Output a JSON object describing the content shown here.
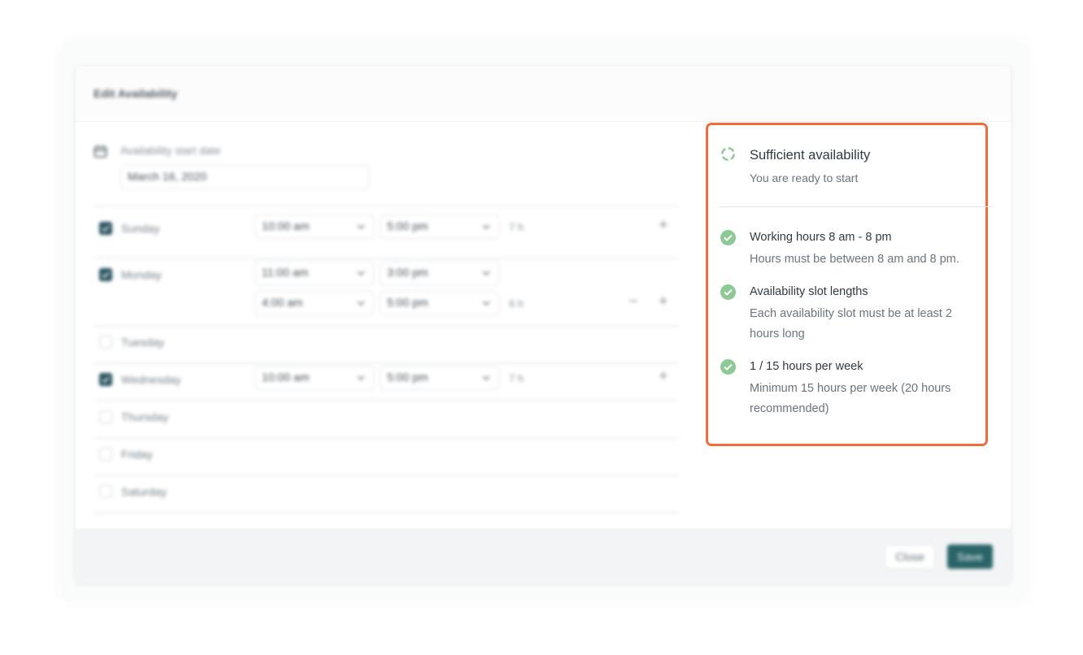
{
  "modal": {
    "title": "Edit Availability",
    "start_date_label": "Availability start date",
    "start_date_value": "March 16, 2020"
  },
  "days": [
    {
      "name": "Sunday",
      "checked": true,
      "slots": [
        {
          "start": "10:00 am",
          "end": "5:00 pm"
        }
      ],
      "duration": "7 h"
    },
    {
      "name": "Monday",
      "checked": true,
      "slots": [
        {
          "start": "11:00 am",
          "end": "3:00 pm"
        },
        {
          "start": "4:00 am",
          "end": "5:00 pm"
        }
      ],
      "duration": "6 h"
    },
    {
      "name": "Tuesday",
      "checked": false,
      "slots": [],
      "duration": ""
    },
    {
      "name": "Wednesday",
      "checked": true,
      "slots": [
        {
          "start": "10:00 am",
          "end": "5:00 pm"
        }
      ],
      "duration": "7 h"
    },
    {
      "name": "Thursday",
      "checked": false,
      "slots": [],
      "duration": ""
    },
    {
      "name": "Friday",
      "checked": false,
      "slots": [],
      "duration": ""
    },
    {
      "name": "Saturday",
      "checked": false,
      "slots": [],
      "duration": ""
    }
  ],
  "footer": {
    "close_label": "Close",
    "save_label": "Save"
  },
  "status_panel": {
    "title": "Sufficient availability",
    "subtitle": "You are ready to start",
    "criteria": [
      {
        "title": "Working hours 8 am - 8 pm",
        "description": "Hours must be between 8 am and 8 pm."
      },
      {
        "title": "Availability slot lengths",
        "description": "Each availability slot must be at least 2 hours long"
      },
      {
        "title": "1 / 15  hours per week",
        "description": "Minimum 15 hours per week (20 hours recommended)"
      }
    ]
  },
  "colors": {
    "highlight_border": "#f26b3a",
    "check_green": "#8cc994",
    "save_button": "#2a6468",
    "checkbox_checked": "#2a5360"
  }
}
